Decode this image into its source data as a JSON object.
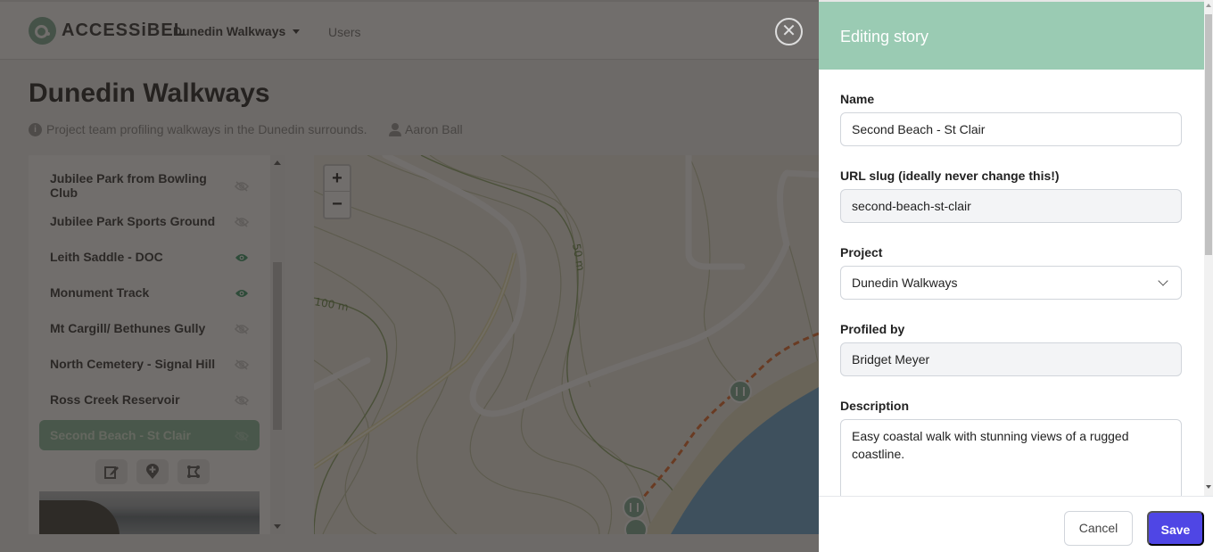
{
  "header": {
    "logo_text": "ACCESSiBEL",
    "project_menu": "Dunedin Walkways",
    "users_link": "Users"
  },
  "page": {
    "title": "Dunedin Walkways",
    "description": "Project team profiling walkways in the Dunedin surrounds.",
    "owner": "Aaron Ball"
  },
  "stories": [
    {
      "name": "Jubilee Park from Bowling Club",
      "visible": false
    },
    {
      "name": "Jubilee Park Sports Ground",
      "visible": false
    },
    {
      "name": "Leith Saddle - DOC",
      "visible": true
    },
    {
      "name": "Monument Track",
      "visible": true
    },
    {
      "name": "Mt Cargill/ Bethunes Gully",
      "visible": false
    },
    {
      "name": "North Cemetery - Signal Hill",
      "visible": false
    },
    {
      "name": "Ross Creek Reservoir",
      "visible": false
    },
    {
      "name": "Second Beach - St Clair",
      "visible": false,
      "selected": true
    }
  ],
  "story_actions": [
    "edit-icon",
    "add-marker-icon",
    "route-icon"
  ],
  "map": {
    "zoom_in": "+",
    "zoom_out": "−",
    "contour_labels": [
      "100 m",
      "50 m"
    ]
  },
  "drawer": {
    "title": "Editing story",
    "fields": {
      "name": {
        "label": "Name",
        "value": "Second Beach - St Clair"
      },
      "slug": {
        "label": "URL slug (ideally never change this!)",
        "value": "second-beach-st-clair"
      },
      "project": {
        "label": "Project",
        "value": "Dunedin Walkways"
      },
      "profiled_by": {
        "label": "Profiled by",
        "value": "Bridget Meyer"
      },
      "description": {
        "label": "Description",
        "value": "Easy coastal walk with stunning views of a rugged coastline."
      }
    },
    "cancel_label": "Cancel",
    "save_label": "Save"
  },
  "colors": {
    "drawer_header": "#9acbb3",
    "save_button": "#4f46e5",
    "visible_eye": "#3b9a6b",
    "route": "#e8692a"
  }
}
